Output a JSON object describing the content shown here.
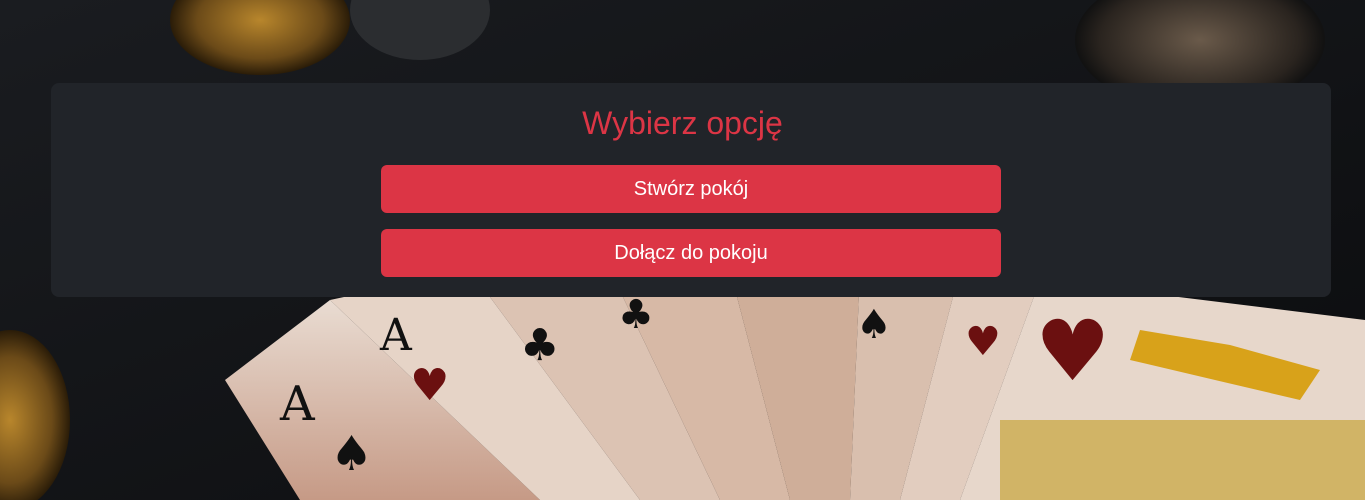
{
  "menu": {
    "title": "Wybierz opcję",
    "create_room_label": "Stwórz pokój",
    "join_room_label": "Dołącz do pokoju"
  },
  "background": {
    "description_icon": "playing-cards-background",
    "accent_color": "#dc3545",
    "panel_color": "#212429"
  }
}
